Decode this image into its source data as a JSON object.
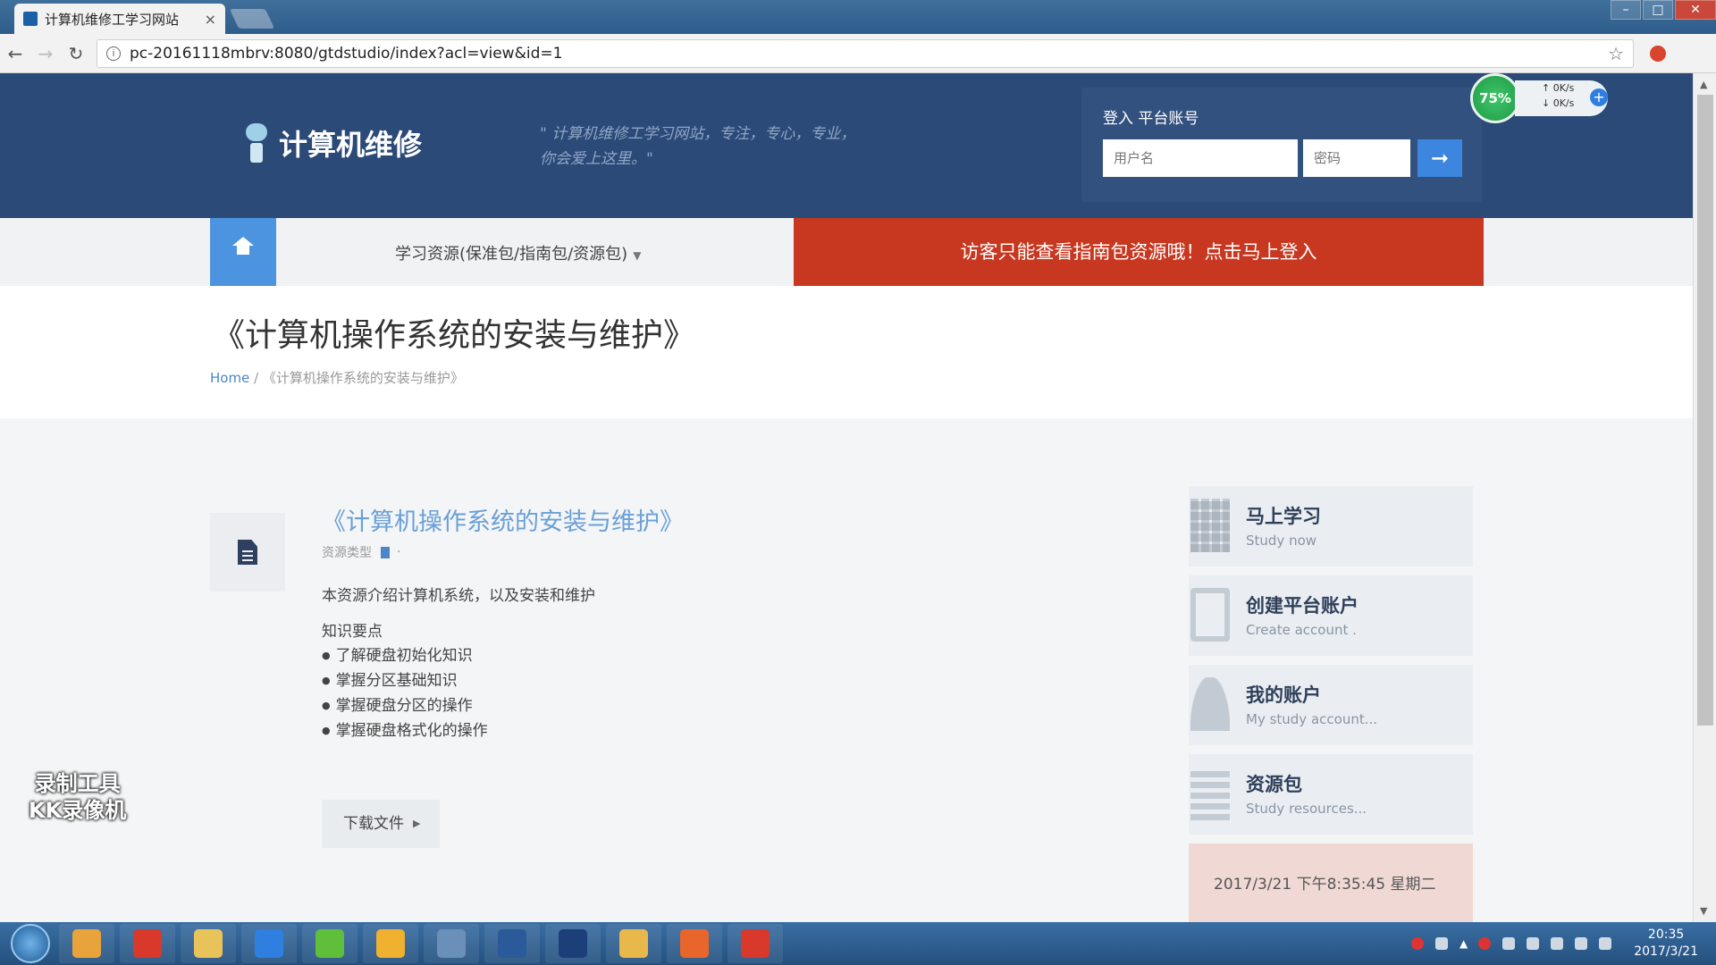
{
  "browser": {
    "tab_title": "计算机维修工学习网站",
    "tab_close": "×",
    "url": "pc-20161118mbrv:8080/gtdstudio/index?acl=view&id=1",
    "window_controls": [
      "–",
      "□",
      "✕"
    ]
  },
  "header": {
    "logo_text": "计算机维修",
    "slogan_line1": "\" 计算机维修工学习网站，专注，专心，专业，",
    "slogan_line2": "你会爱上这里。\"",
    "login": {
      "title": "登入 平台账号",
      "username_placeholder": "用户名",
      "password_placeholder": "密码",
      "submit_icon": "➞"
    }
  },
  "netmon": {
    "percent": "75%",
    "up": "0K/s",
    "down": "0K/s",
    "up_arrow": "↑",
    "down_arrow": "↓",
    "add": "+"
  },
  "navbar": {
    "home_icon": "home-icon",
    "resources_menu": "学习资源(保准包/指南包/资源包)",
    "caret": "▼",
    "guest_banner": "访客只能查看指南包资源哦！点击马上登入"
  },
  "title_section": {
    "title": "《计算机操作系统的安装与维护》",
    "breadcrumb_home": "Home",
    "breadcrumb_sep": " / ",
    "breadcrumb_current": "《计算机操作系统的安装与维护》"
  },
  "resource": {
    "title": "《计算机操作系统的安装与维护》",
    "type_label": "资源类型",
    "type_dot": "·",
    "description": "本资源介绍计算机系统，以及安装和维护",
    "key_points_title": "知识要点",
    "key_points": [
      "了解硬盘初始化知识",
      "掌握分区基础知识",
      "掌握硬盘分区的操作",
      "掌握硬盘格式化的操作"
    ],
    "download_label": "下载文件",
    "download_arrow": "▶"
  },
  "sidebar": {
    "items": [
      {
        "title": "马上学习",
        "subtitle": "Study now"
      },
      {
        "title": "创建平台账户",
        "subtitle": "Create account ."
      },
      {
        "title": "我的账户",
        "subtitle": "My study account..."
      },
      {
        "title": "资源包",
        "subtitle": "Study resources..."
      }
    ],
    "clock": "2017/3/21 下午8:35:45 星期二"
  },
  "watermark": {
    "line1": "录制工具",
    "line2": "KK录像机"
  },
  "taskbar": {
    "apps": [
      {
        "name": "chrome",
        "color": "#e8a33b"
      },
      {
        "name": "netease-music",
        "color": "#d8392b"
      },
      {
        "name": "file-explorer",
        "color": "#e8c35a"
      },
      {
        "name": "wps-writer",
        "color": "#2f7fe0"
      },
      {
        "name": "green-app",
        "color": "#5fbf3a"
      },
      {
        "name": "volume-app",
        "color": "#f0b030"
      },
      {
        "name": "image-viewer",
        "color": "#6a8fb8"
      },
      {
        "name": "script-app",
        "color": "#2a5a9a"
      },
      {
        "name": "photoshop",
        "color": "#1c3f7a"
      },
      {
        "name": "paint-app",
        "color": "#e8b84a"
      },
      {
        "name": "wps-presentation",
        "color": "#e8662b"
      },
      {
        "name": "kk-recorder",
        "color": "#d8392b"
      }
    ],
    "tray_arrow": "▲",
    "time": "20:35",
    "date": "2017/3/21"
  }
}
